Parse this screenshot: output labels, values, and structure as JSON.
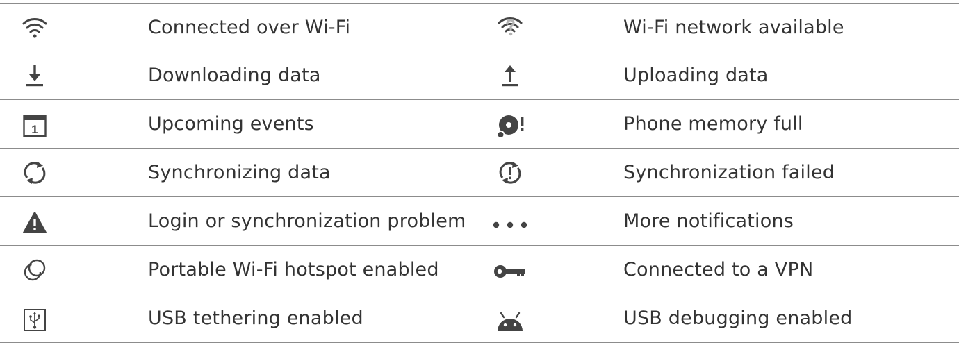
{
  "rows": [
    {
      "left": {
        "icon": "wifi-connected-icon",
        "label": "Connected over Wi-Fi"
      },
      "right": {
        "icon": "wifi-available-icon",
        "label": "Wi-Fi network available"
      }
    },
    {
      "left": {
        "icon": "download-icon",
        "label": "Downloading data"
      },
      "right": {
        "icon": "upload-icon",
        "label": "Uploading data"
      }
    },
    {
      "left": {
        "icon": "calendar-icon",
        "label": "Upcoming events"
      },
      "right": {
        "icon": "memory-full-icon",
        "label": "Phone memory full"
      }
    },
    {
      "left": {
        "icon": "sync-icon",
        "label": "Synchronizing data"
      },
      "right": {
        "icon": "sync-failed-icon",
        "label": "Synchronization failed"
      }
    },
    {
      "left": {
        "icon": "warning-icon",
        "label": "Login or synchronization problem"
      },
      "right": {
        "icon": "more-notifications-icon",
        "label": "More notifications"
      }
    },
    {
      "left": {
        "icon": "hotspot-icon",
        "label": "Portable Wi-Fi hotspot enabled"
      },
      "right": {
        "icon": "vpn-key-icon",
        "label": "Connected to a VPN"
      }
    },
    {
      "left": {
        "icon": "usb-tethering-icon",
        "label": "USB tethering enabled"
      },
      "right": {
        "icon": "android-debug-icon",
        "label": "USB debugging enabled"
      }
    }
  ],
  "calendar_day": "1",
  "colors": {
    "text": "#333333",
    "icon": "#444444",
    "rule": "#8c8c8c",
    "icon_light": "#b3b3b3"
  }
}
